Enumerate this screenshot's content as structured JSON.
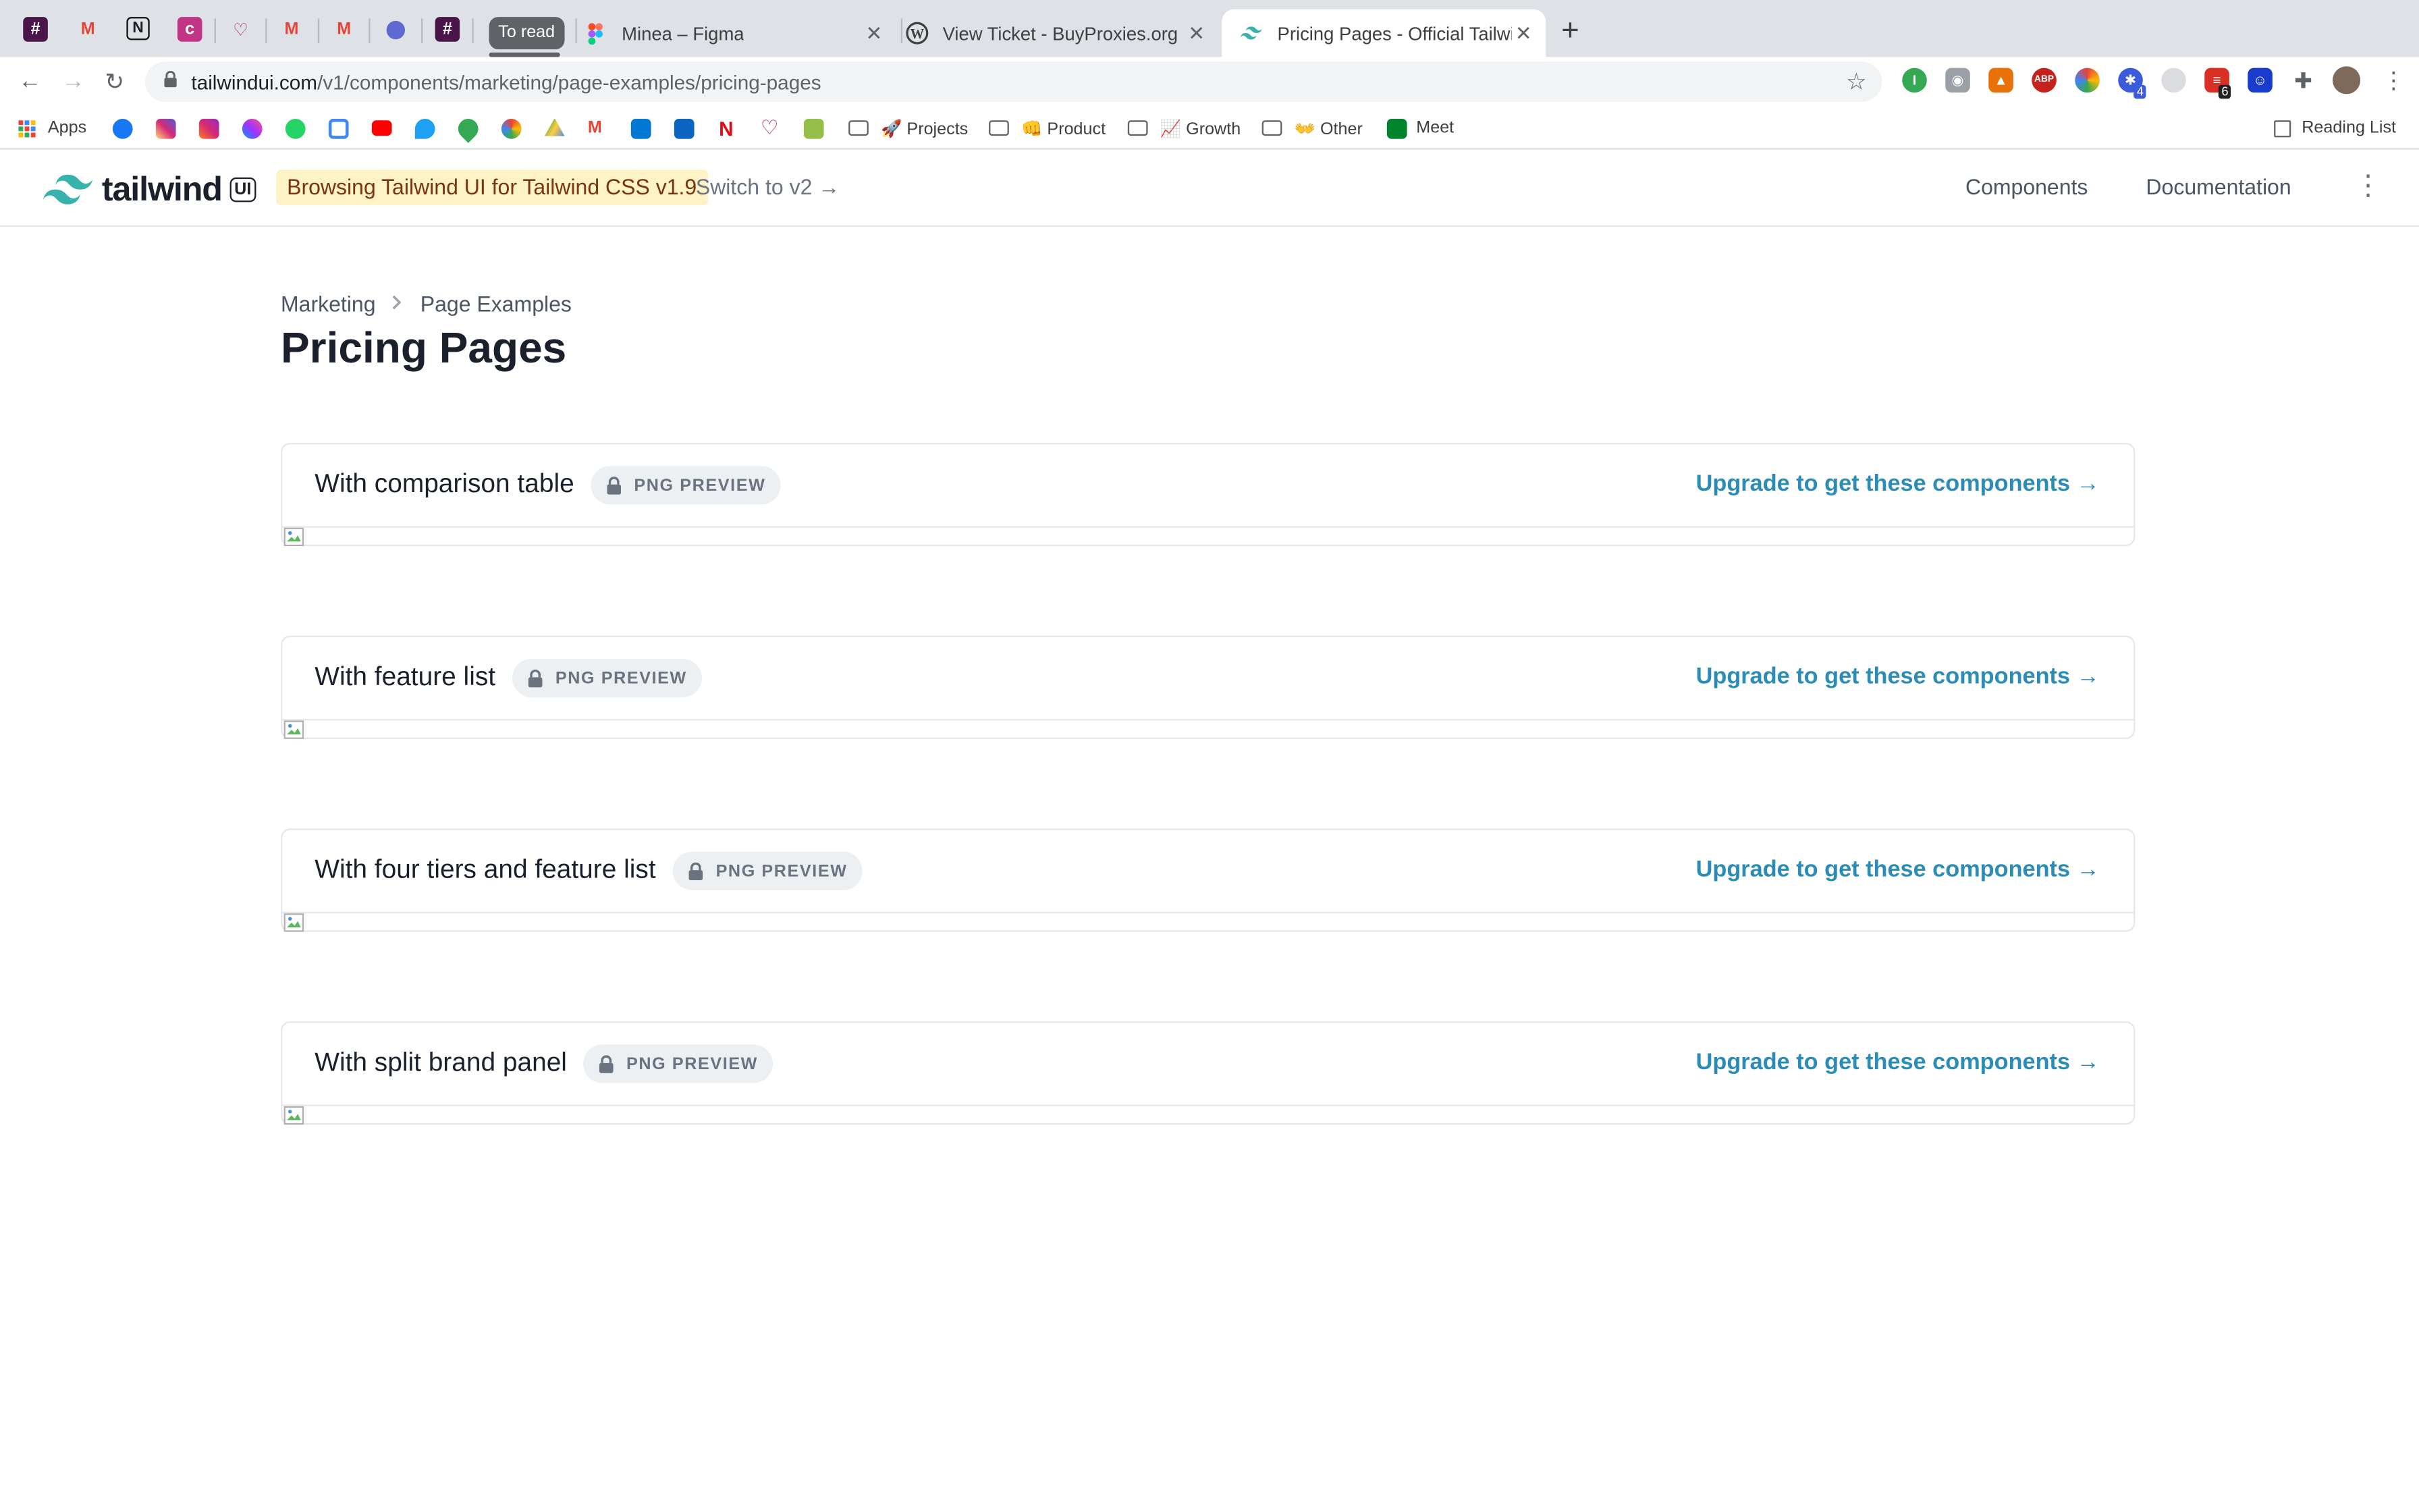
{
  "browser": {
    "tab_group_label": "To read",
    "tabs": [
      {
        "title": "Minea – Figma",
        "favicon": "figma-icon"
      },
      {
        "title": "View Ticket - BuyProxies.org",
        "favicon": "wordpress-icon"
      },
      {
        "title": "Pricing Pages - Official Tailwind",
        "favicon": "tailwind-icon",
        "active": true
      }
    ],
    "url_domain": "tailwindui.com",
    "url_path": "/v1/components/marketing/page-examples/pricing-pages",
    "extension_badges": [
      "4",
      "6"
    ],
    "bookmarks": {
      "apps": "Apps",
      "projects": "🚀 Projects",
      "product": "👊 Product",
      "growth": "📈 Growth",
      "other": "👐 Other",
      "meet": "Meet",
      "reading_list": "Reading List"
    }
  },
  "site": {
    "logo_word": "tailwind",
    "logo_badge": "UI",
    "notice": "Browsing Tailwind UI for Tailwind CSS v1.9",
    "switch_link": "Switch to v2 →",
    "nav": [
      "Components",
      "Documentation"
    ]
  },
  "breadcrumb": [
    "Marketing",
    "Page Examples"
  ],
  "page_title": "Pricing Pages",
  "cards": [
    {
      "title": "With comparison table",
      "badge": "PNG PREVIEW",
      "cta": "Upgrade to get these components →"
    },
    {
      "title": "With feature list",
      "badge": "PNG PREVIEW",
      "cta": "Upgrade to get these components →"
    },
    {
      "title": "With four tiers and feature list",
      "badge": "PNG PREVIEW",
      "cta": "Upgrade to get these components →"
    },
    {
      "title": "With split brand panel",
      "badge": "PNG PREVIEW",
      "cta": "Upgrade to get these components →"
    }
  ],
  "colors": {
    "accent_link": "#2b8cb5",
    "notice_bg": "#fef3c7",
    "tailwind_teal": "#38b2ac"
  }
}
